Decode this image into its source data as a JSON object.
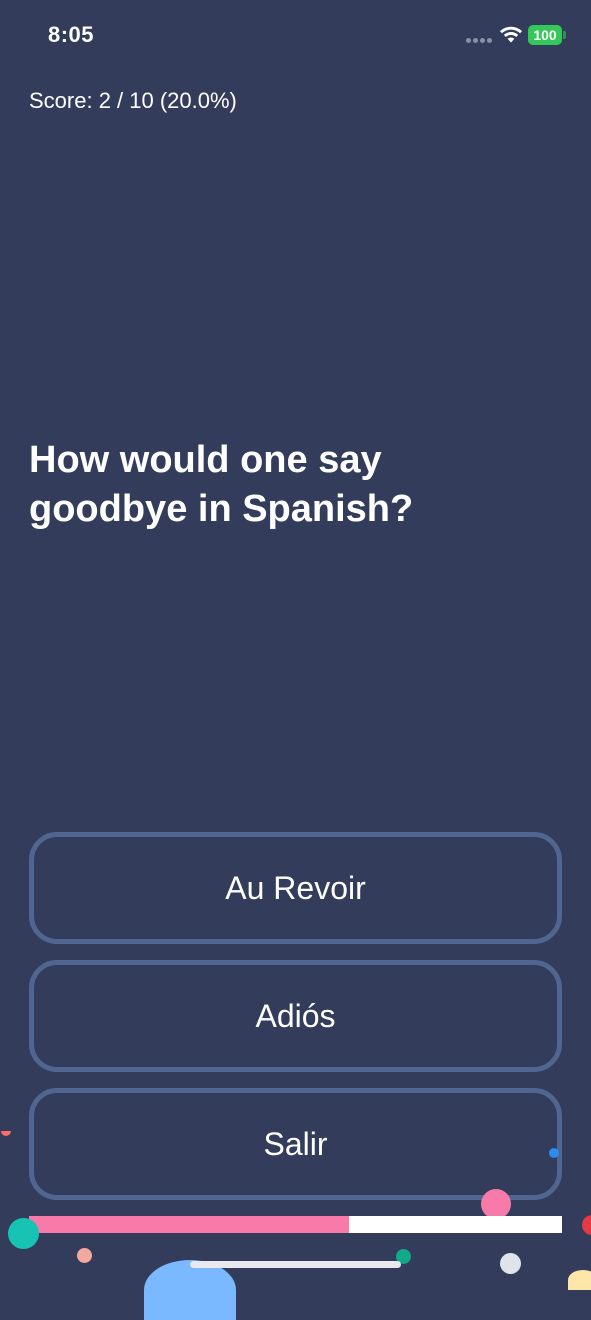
{
  "status_bar": {
    "time": "8:05",
    "battery": "100"
  },
  "quiz": {
    "score_text": "Score: 2 / 10 (20.0%)",
    "question": "How would one say goodbye in Spanish?",
    "answers": [
      "Au Revoir",
      "Adiós",
      "Salir"
    ],
    "progress_fraction": 0.6
  },
  "colors": {
    "background": "#333d5b",
    "button_border": "#4f6690",
    "progress_fill": "#f77aa8",
    "progress_track": "#ffffff",
    "battery": "#34c759"
  }
}
